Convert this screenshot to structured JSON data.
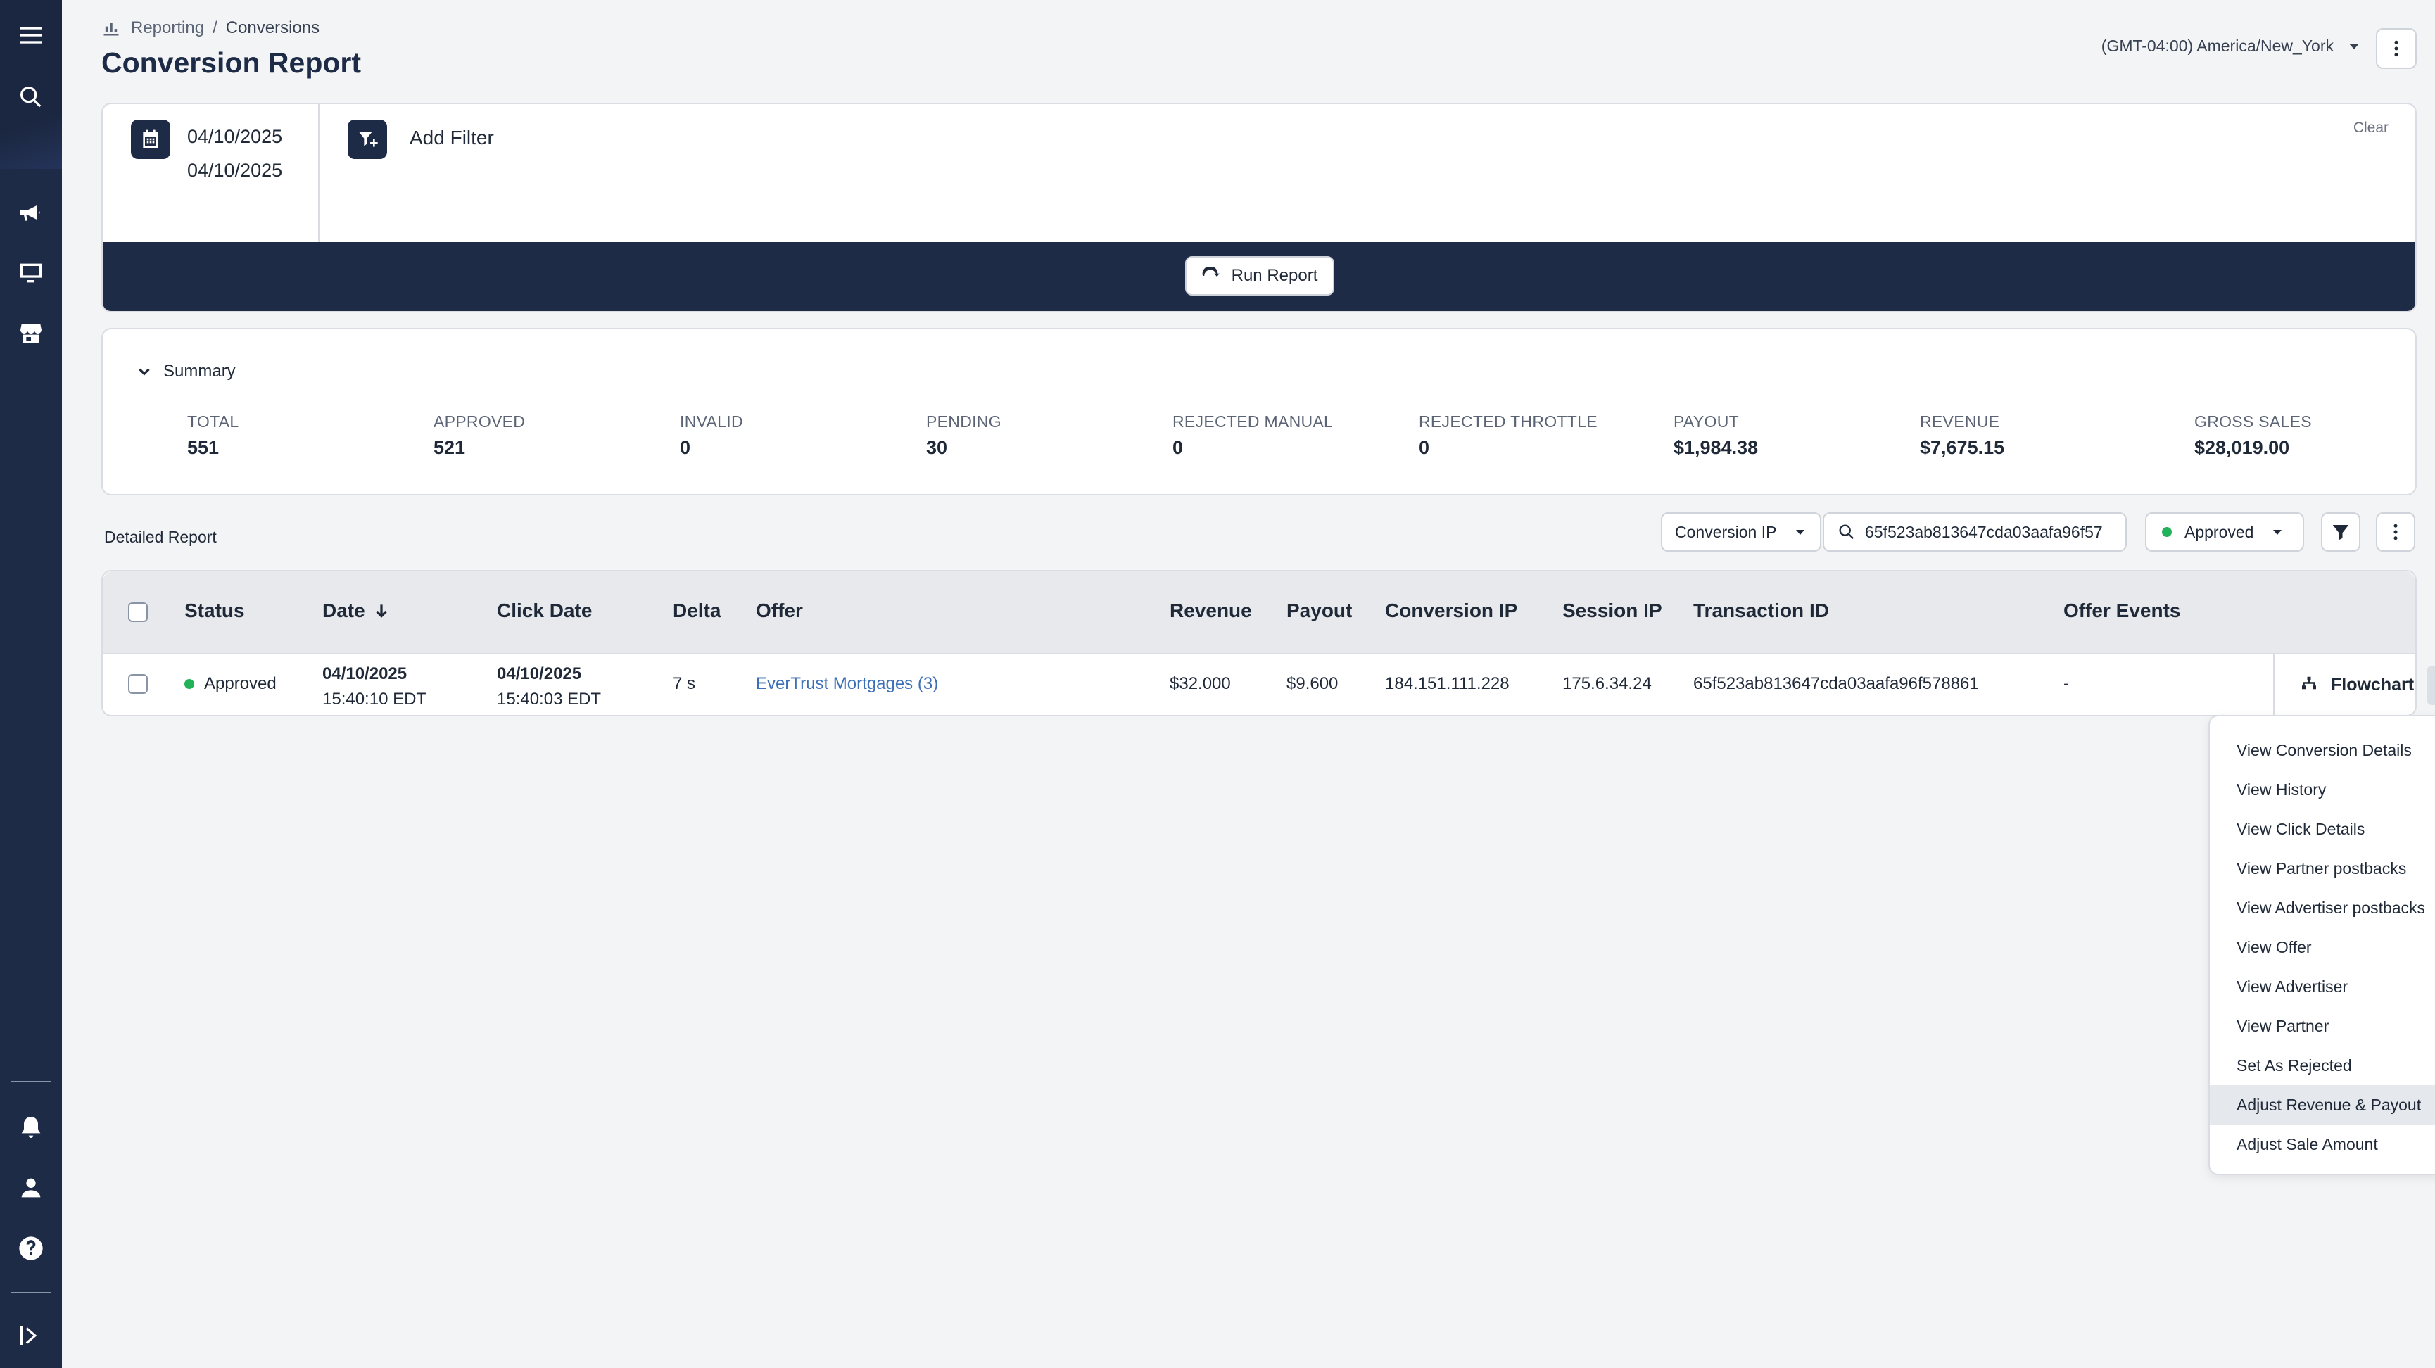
{
  "breadcrumb": {
    "parent": "Reporting",
    "separator": "/",
    "current": "Conversions"
  },
  "page_title": "Conversion Report",
  "timezone": {
    "value": "(GMT-04:00) America/New_York"
  },
  "filters": {
    "date_start": "04/10/2025",
    "date_end": "04/10/2025",
    "add_filter_label": "Add Filter",
    "clear_label": "Clear",
    "run_report_label": "Run Report"
  },
  "summary": {
    "toggle_label": "Summary",
    "metrics": [
      {
        "label": "TOTAL",
        "value": "551"
      },
      {
        "label": "APPROVED",
        "value": "521"
      },
      {
        "label": "INVALID",
        "value": "0"
      },
      {
        "label": "PENDING",
        "value": "30"
      },
      {
        "label": "REJECTED MANUAL",
        "value": "0"
      },
      {
        "label": "REJECTED THROTTLE",
        "value": "0"
      },
      {
        "label": "PAYOUT",
        "value": "$1,984.38"
      },
      {
        "label": "REVENUE",
        "value": "$7,675.15"
      },
      {
        "label": "GROSS SALES",
        "value": "$28,019.00"
      }
    ]
  },
  "detail": {
    "title": "Detailed Report",
    "search_field_select": "Conversion IP",
    "search_value": "65f523ab813647cda03aafa96f57",
    "status_filter": "Approved",
    "status_color": "#22b25a"
  },
  "table": {
    "headers": [
      "Status",
      "Date",
      "Click Date",
      "Delta",
      "Offer",
      "Revenue",
      "Payout",
      "Conversion IP",
      "Session IP",
      "Transaction ID",
      "Offer Events"
    ],
    "rows": [
      {
        "status": "Approved",
        "date": "04/10/2025",
        "date_time": "15:40:10 EDT",
        "click_date": "04/10/2025",
        "click_time": "15:40:03 EDT",
        "delta": "7 s",
        "offer": "EverTrust Mortgages (3)",
        "revenue": "$32.000",
        "payout": "$9.600",
        "conversion_ip": "184.151.111.228",
        "session_ip": "175.6.34.24",
        "transaction_id": "65f523ab813647cda03aafa96f578861",
        "offer_events": "-",
        "action_label": "Flowchart"
      }
    ]
  },
  "row_menu": {
    "items": [
      "View Conversion Details",
      "View History",
      "View Click Details",
      "View Partner postbacks",
      "View Advertiser postbacks",
      "View Offer",
      "View Advertiser",
      "View Partner",
      "Set As Rejected",
      "Adjust Revenue & Payout",
      "Adjust Sale Amount"
    ],
    "highlighted": "Adjust Revenue & Payout"
  },
  "icons": {
    "sidebar": [
      "menu-icon",
      "search-icon",
      "megaphone-icon",
      "monitor-icon",
      "store-icon",
      "bell-icon",
      "user-icon",
      "help-icon",
      "expand-icon"
    ]
  },
  "colors": {
    "navy": "#1e2b47",
    "link": "#3b6fb6",
    "approved": "#22b25a"
  }
}
